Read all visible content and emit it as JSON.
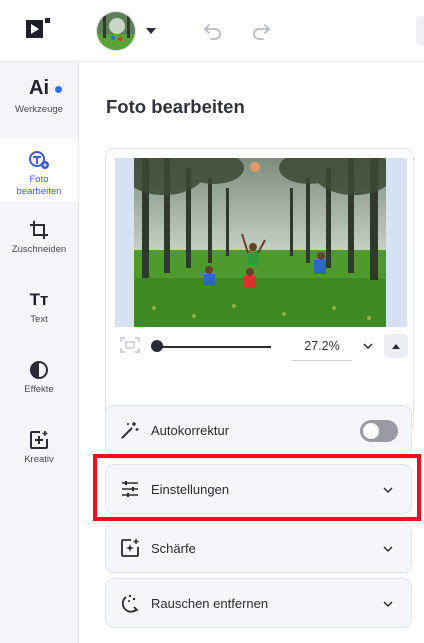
{
  "topbar": {
    "logo_icon": "play-logo-icon",
    "avatar_icon": "profile-photo-avatar",
    "undo_icon": "undo-icon",
    "redo_icon": "redo-icon"
  },
  "sidebar": {
    "items": [
      {
        "label": "Werkzeuge",
        "icon_text": "Ai",
        "icon": "ai-tools-icon",
        "has_dot": true
      },
      {
        "label": "Foto bearbeiten",
        "icon": "photo-edit-icon",
        "active": true
      },
      {
        "label": "Zuschneiden",
        "icon": "crop-icon"
      },
      {
        "label": "Text",
        "icon_text": "Tт",
        "icon": "text-icon"
      },
      {
        "label": "Effekte",
        "icon": "effects-icon"
      },
      {
        "label": "Kreativ",
        "icon": "creative-icon"
      }
    ]
  },
  "main": {
    "title": "Foto bearbeiten",
    "zoom": {
      "value": "27.2%"
    },
    "options": [
      {
        "label": "Autokorrektur",
        "icon": "magic-wand-icon",
        "control": "toggle",
        "on": false
      },
      {
        "label": "Einstellungen",
        "icon": "sliders-icon",
        "control": "chevron",
        "highlighted": true
      },
      {
        "label": "Schärfe",
        "icon": "sharpen-icon",
        "control": "chevron"
      },
      {
        "label": "Rauschen entfernen",
        "icon": "denoise-icon",
        "control": "chevron"
      }
    ]
  },
  "colors": {
    "accent": "#3b5bdb",
    "highlight": "#e5141b",
    "notification_dot": "#2f6bff"
  }
}
